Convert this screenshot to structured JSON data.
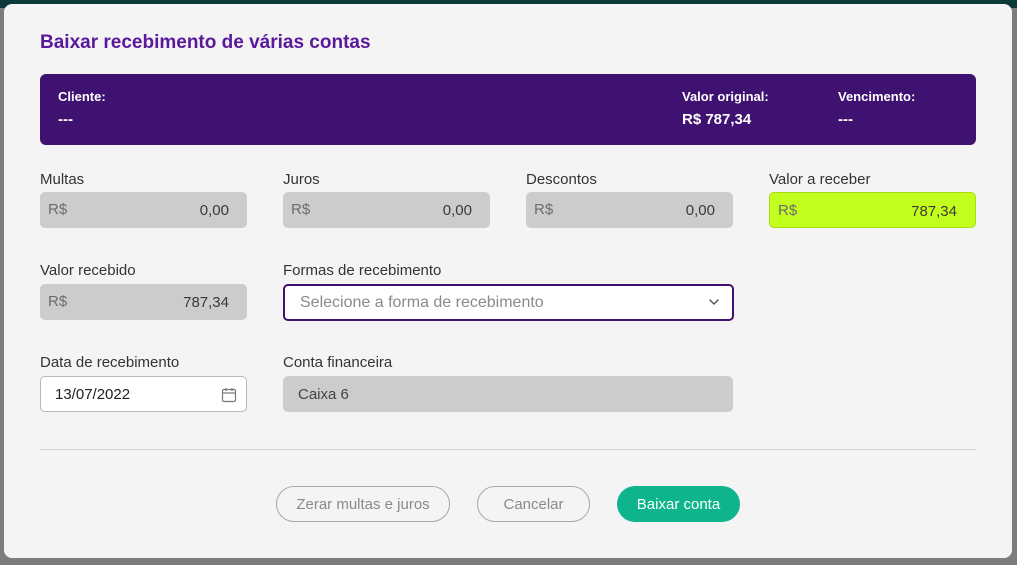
{
  "dialog": {
    "title": "Baixar recebimento de várias contas"
  },
  "summary": {
    "cliente_label": "Cliente:",
    "cliente_value": "---",
    "valor_original_label": "Valor original:",
    "valor_original_value": "R$ 787,34",
    "vencimento_label": "Vencimento:",
    "vencimento_value": "---"
  },
  "fields": {
    "currency_prefix": "R$",
    "multas": {
      "label": "Multas",
      "value": "0,00"
    },
    "juros": {
      "label": "Juros",
      "value": "0,00"
    },
    "descontos": {
      "label": "Descontos",
      "value": "0,00"
    },
    "valor_a_receber": {
      "label": "Valor a receber",
      "value": "787,34"
    },
    "valor_recebido": {
      "label": "Valor recebido",
      "value": "787,34"
    },
    "formas_recebimento": {
      "label": "Formas de recebimento",
      "placeholder": "Selecione a forma de recebimento"
    },
    "data_recebimento": {
      "label": "Data de recebimento",
      "value": "13/07/2022"
    },
    "conta_financeira": {
      "label": "Conta financeira",
      "value": "Caixa 6"
    }
  },
  "buttons": {
    "zerar": "Zerar multas e juros",
    "cancelar": "Cancelar",
    "baixar": "Baixar conta"
  },
  "colors": {
    "title_purple": "#5a189a",
    "summary_bg": "#3f1170",
    "highlight_green": "#c3ff1e",
    "primary_button": "#0db48c"
  },
  "icons": {
    "select_chevron": "chevron-down-icon",
    "date_picker": "calendar-icon"
  }
}
